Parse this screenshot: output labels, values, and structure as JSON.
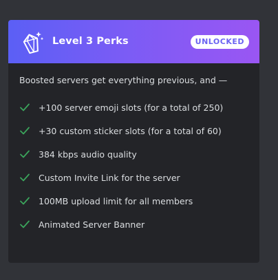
{
  "card": {
    "title": "Level 3 Perks",
    "badge": "UNLOCKED",
    "icon": "gem-icon",
    "intro": "Boosted servers get everything previous, and —",
    "perks": [
      "+100 server emoji slots (for a total of 250)",
      "+30 custom sticker slots (for a total of 60)",
      "384 kbps audio quality",
      "Custom Invite Link for the server",
      "100MB upload limit for all members",
      "Animated Server Banner"
    ]
  },
  "colors": {
    "background": "#313338",
    "card": "#232428",
    "header_start": "#5b5ff5",
    "header_end": "#9a56f3",
    "check": "#3ba55c",
    "badge_text": "#6b63f2"
  }
}
